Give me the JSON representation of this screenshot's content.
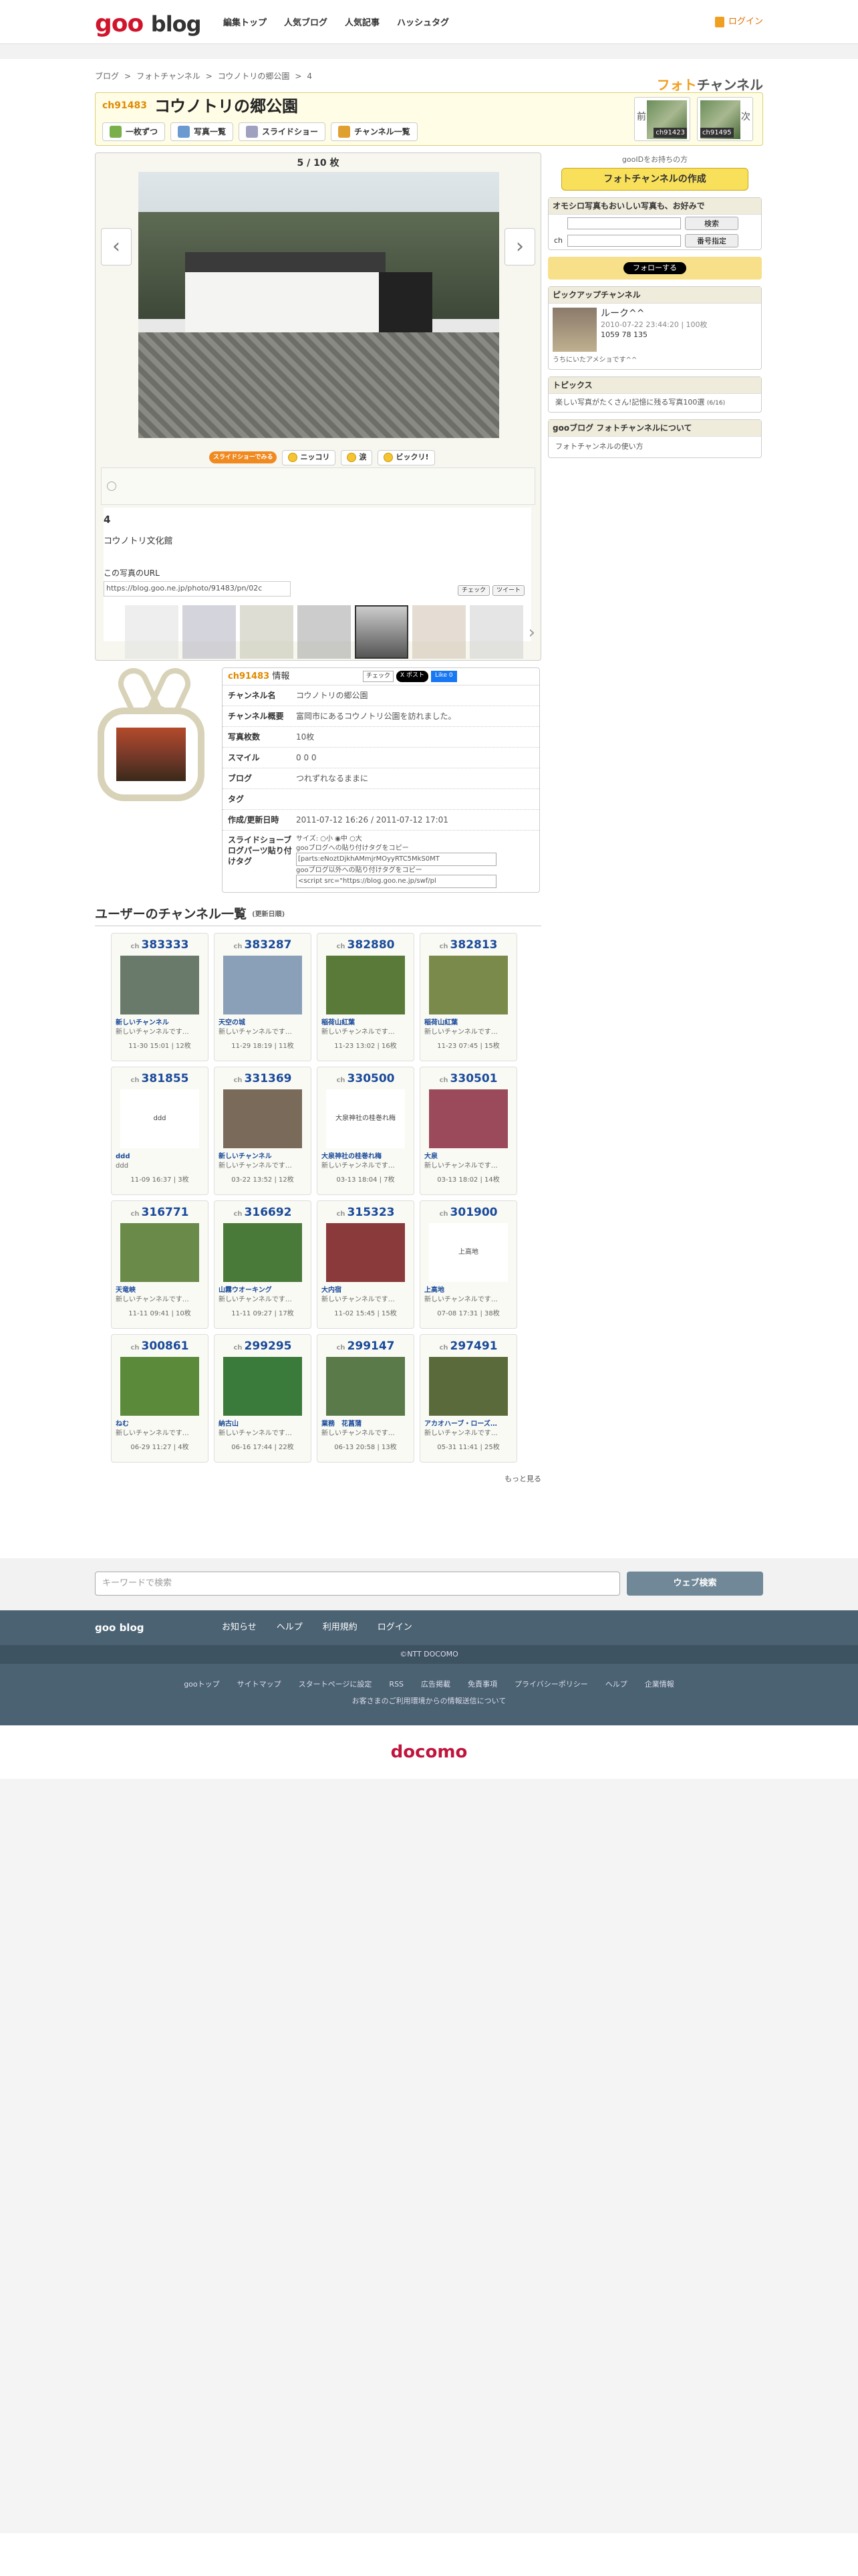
{
  "header": {
    "logo_goo": "goo",
    "logo_blog": "blog",
    "nav": [
      "編集トップ",
      "人気ブログ",
      "人気記事",
      "ハッシュタグ"
    ],
    "login": "ログイン"
  },
  "breadcrumb": [
    "ブログ",
    "フォトチャンネル",
    "コウノトリの郷公園",
    "4"
  ],
  "brand": {
    "a": "フォト",
    "b": "チャンネル"
  },
  "channel": {
    "no": "ch91483",
    "title": "コウノトリの郷公園",
    "buttons": [
      "一枚ずつ",
      "写真一覧",
      "スライドショー",
      "チャンネル一覧"
    ],
    "prev_label": "前",
    "next_label": "次",
    "prev_no": "ch91423",
    "next_no": "ch91495"
  },
  "photo": {
    "counter": "5 / 10 枚",
    "slideshow": "スライドショーでみる",
    "reactions": [
      "ニッコリ",
      "涙",
      "ビックリ!"
    ],
    "number": "4",
    "desc": "コウノトリ文化館",
    "url_label": "この写真のURL",
    "url": "https://blog.goo.ne.jp/photo/91483/pn/02c",
    "share": [
      "チェック",
      "ツイート"
    ]
  },
  "chinfo": {
    "head_no": "ch91483",
    "head_label": "情報",
    "badges": [
      "チェック",
      "X ポスト",
      "Like 0"
    ],
    "rows": [
      {
        "k": "チャンネル名",
        "v": "コウノトリの郷公園"
      },
      {
        "k": "チャンネル概要",
        "v": "富岡市にあるコウノトリ公園を訪れました。"
      },
      {
        "k": "写真枚数",
        "v": "10枚"
      },
      {
        "k": "スマイル",
        "v": "0  0  0"
      },
      {
        "k": "ブログ",
        "v": "つれずれなるままに"
      },
      {
        "k": "タグ",
        "v": ""
      },
      {
        "k": "作成/更新日時",
        "v": "2011-07-12 16:26 / 2011-07-12 17:01"
      }
    ],
    "parts_label": "スライドショーブログパーツ貼り付けタグ",
    "size_label": "サイズ:",
    "sizes": [
      "小",
      "中",
      "大"
    ],
    "copy1": "gooブログへの貼り付けタグをコピー",
    "code1": "[parts:eNoztDjkhAMmjrMOyyRTC5MkS0MT",
    "copy2": "gooブログ以外への貼り付けタグをコピー",
    "code2": "<script src=\"https://blog.goo.ne.jp/swf/pl"
  },
  "list": {
    "title": "ユーザーのチャンネル一覧",
    "sub": "(更新日順)",
    "more": "もっと見る",
    "cards": [
      {
        "no": "383333",
        "t": "新しいチャンネル",
        "d": "新しいチャンネルです…",
        "m": "11-30 15:01 | 12枚"
      },
      {
        "no": "383287",
        "t": "天空の城",
        "d": "新しいチャンネルです…",
        "m": "11-29 18:19 | 11枚"
      },
      {
        "no": "382880",
        "t": "稲荷山紅葉",
        "d": "新しいチャンネルです…",
        "m": "11-23 13:02 | 16枚"
      },
      {
        "no": "382813",
        "t": "稲荷山紅葉",
        "d": "新しいチャンネルです…",
        "m": "11-23 07:45 | 15枚"
      },
      {
        "no": "381855",
        "t": "ddd",
        "d": "ddd",
        "m": "11-09 16:37 | 3枚",
        "alt": "ddd"
      },
      {
        "no": "331369",
        "t": "新しいチャンネル",
        "d": "新しいチャンネルです…",
        "m": "03-22 13:52 | 12枚"
      },
      {
        "no": "330500",
        "t": "大泉神社の桂巻れ梅",
        "d": "新しいチャンネルです…",
        "m": "03-13 18:04 | 7枚",
        "alt": "大泉神社の桂巻れ梅"
      },
      {
        "no": "330501",
        "t": "大泉",
        "d": "新しいチャンネルです…",
        "m": "03-13 18:02 | 14枚"
      },
      {
        "no": "316771",
        "t": "天竜峡",
        "d": "新しいチャンネルです…",
        "m": "11-11 09:41 | 10枚"
      },
      {
        "no": "316692",
        "t": "山霧ウオーキング",
        "d": "新しいチャンネルです…",
        "m": "11-11 09:27 | 17枚"
      },
      {
        "no": "315323",
        "t": "大内宿",
        "d": "新しいチャンネルです…",
        "m": "11-02 15:45 | 15枚"
      },
      {
        "no": "301900",
        "t": "上高地",
        "d": "新しいチャンネルです…",
        "m": "07-08 17:31 | 38枚",
        "alt": "上高地"
      },
      {
        "no": "300861",
        "t": "ねむ",
        "d": "新しいチャンネルです…",
        "m": "06-29 11:27 | 4枚"
      },
      {
        "no": "299295",
        "t": "納古山",
        "d": "新しいチャンネルです…",
        "m": "06-16 17:44 | 22枚"
      },
      {
        "no": "299147",
        "t": "業務　花菖蒲",
        "d": "新しいチャンネルです…",
        "m": "06-13 20:58 | 13枚"
      },
      {
        "no": "297491",
        "t": "アカオハーブ・ローズ…",
        "d": "新しいチャンネルです…",
        "m": "05-31 11:41 | 25枚"
      }
    ]
  },
  "side": {
    "gooid": "gooIDをお持ちの方",
    "create": "フォトチャンネルの作成",
    "search_h": "オモシロ写真もおいしい写真も、お好みで",
    "search_btn": "検索",
    "ch_label": "ch",
    "no_btn": "番号指定",
    "follow": "フォローする",
    "pickup_h": "ピックアップチャンネル",
    "pickup_name": "ルーク^^",
    "pickup_meta": "2010-07-22 23:44:20 | 100枚",
    "pickup_counts": "1059  78  135",
    "pickup_desc": "うちにいたアメショです^^",
    "topics_h": "トピックス",
    "topic": "楽しい写真がたくさん!記憶に残る写真100選",
    "topic_date": "(6/16)",
    "about_h": "gooブログ フォトチャンネルについて",
    "about": "フォトチャンネルの使い方"
  },
  "footer": {
    "placeholder": "キーワードで検索",
    "search": "ウェブ検索",
    "brand": "goo blog",
    "links1": [
      "お知らせ",
      "ヘルプ",
      "利用規約",
      "ログイン"
    ],
    "copy": "©NTT DOCOMO",
    "links2": [
      "gooトップ",
      "サイトマップ",
      "スタートページに設定",
      "RSS",
      "広告掲載",
      "免責事項",
      "プライバシーポリシー",
      "ヘルプ",
      "企業情報"
    ],
    "note": "お客さまのご利用環境からの情報送信について",
    "docomo": "docomo"
  }
}
